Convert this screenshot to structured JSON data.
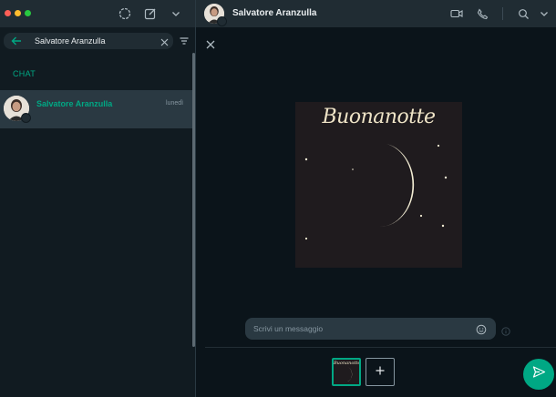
{
  "sidebar": {
    "search": {
      "value": "Salvatore Aranzulla",
      "placeholder": ""
    },
    "section_label": "CHAT",
    "chat": {
      "name": "Salvatore Aranzulla",
      "time": "lunedì"
    }
  },
  "conversation": {
    "contact_name": "Salvatore Aranzulla"
  },
  "preview": {
    "image_text": "Buonanotte",
    "caption_placeholder": "Scrivi un messaggio"
  },
  "icons": {
    "status": "status-ring-icon",
    "new_chat": "compose-icon",
    "menu": "chevron-down-icon",
    "back": "arrow-left-icon",
    "clear": "close-icon",
    "filter": "filter-icon",
    "video": "video-camera-icon",
    "call": "phone-icon",
    "search": "search-icon",
    "close": "close-icon",
    "emoji": "smiley-icon",
    "info": "info-icon",
    "add": "plus-icon",
    "send": "send-icon"
  },
  "colors": {
    "accent": "#00a884",
    "panel": "#202c33",
    "background": "#111b21"
  }
}
